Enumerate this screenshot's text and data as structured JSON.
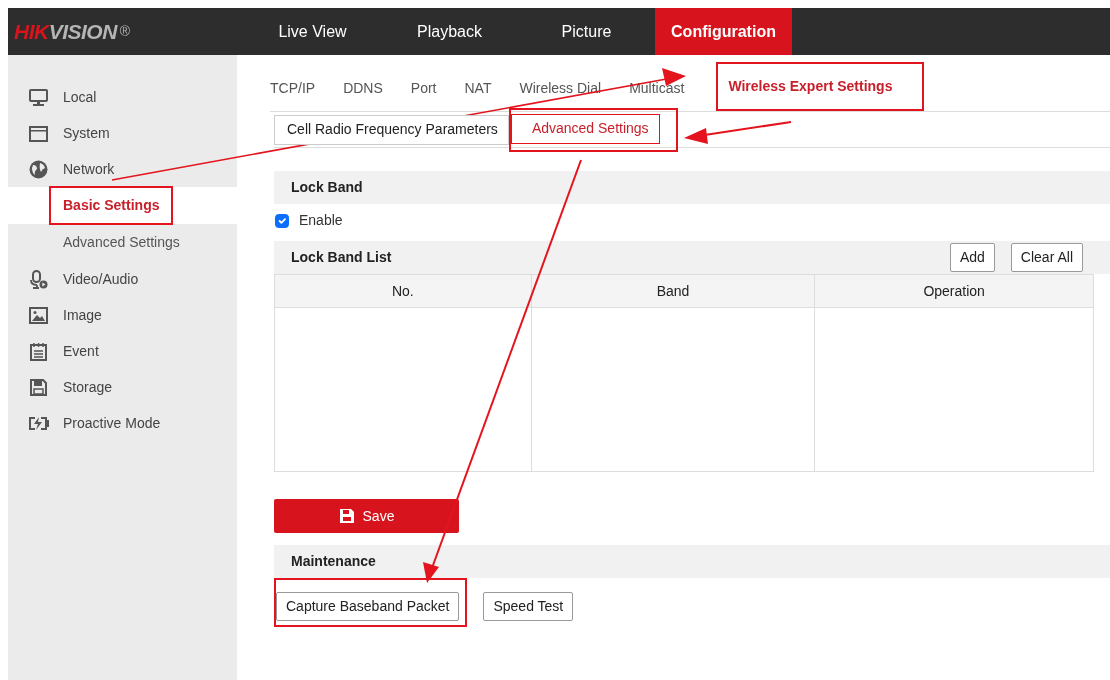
{
  "header": {
    "logo": "HIKVISION",
    "logo_mark": "®",
    "nav": [
      {
        "label": "Live View",
        "selected": false
      },
      {
        "label": "Playback",
        "selected": false
      },
      {
        "label": "Picture",
        "selected": false
      },
      {
        "label": "Configuration",
        "selected": true
      }
    ]
  },
  "sidebar": {
    "items": [
      {
        "label": "Local"
      },
      {
        "label": "System"
      },
      {
        "label": "Network",
        "children": [
          {
            "label": "Basic Settings",
            "selected": true,
            "highlighted": true
          },
          {
            "label": "Advanced Settings",
            "selected": false,
            "highlighted": false
          }
        ]
      },
      {
        "label": "Video/Audio"
      },
      {
        "label": "Image"
      },
      {
        "label": "Event"
      },
      {
        "label": "Storage"
      },
      {
        "label": "Proactive Mode"
      }
    ]
  },
  "tabs": [
    {
      "label": "TCP/IP",
      "selected": false,
      "highlighted": false
    },
    {
      "label": "DDNS",
      "selected": false,
      "highlighted": false
    },
    {
      "label": "Port",
      "selected": false,
      "highlighted": false
    },
    {
      "label": "NAT",
      "selected": false,
      "highlighted": false
    },
    {
      "label": "Wireless Dial",
      "selected": false,
      "highlighted": false
    },
    {
      "label": "Multicast",
      "selected": false,
      "highlighted": false
    },
    {
      "label": "Wireless Expert Settings",
      "selected": true,
      "highlighted": true
    }
  ],
  "subtabs": [
    {
      "label": "Cell Radio Frequency Parameters",
      "selected": false,
      "highlighted": false
    },
    {
      "label": "Advanced Settings",
      "selected": true,
      "highlighted": true
    }
  ],
  "lock_band": {
    "title": "Lock Band",
    "enable": {
      "label": "Enable",
      "checked": true
    }
  },
  "lock_band_list": {
    "title": "Lock Band List",
    "buttons": [
      "Add",
      "Clear All"
    ],
    "columns": [
      "No.",
      "Band",
      "Operation"
    ]
  },
  "save_button": "Save",
  "maintenance": {
    "title": "Maintenance",
    "buttons": [
      {
        "label": "Capture Baseband Packet",
        "highlighted": true
      },
      {
        "label": "Speed Test",
        "highlighted": false
      }
    ]
  }
}
